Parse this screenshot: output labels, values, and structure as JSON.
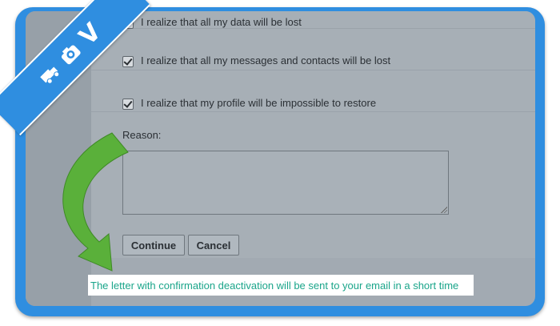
{
  "checkboxes": [
    {
      "label": "I realize that all my data will be lost",
      "checked": true
    },
    {
      "label": "I realize that all my messages and contacts will be lost",
      "checked": true
    },
    {
      "label": "I realize that my profile will be impossible to restore",
      "checked": true
    }
  ],
  "reason": {
    "label": "Reason:",
    "value": ""
  },
  "buttons": {
    "continue": "Continue",
    "cancel": "Cancel"
  },
  "notice": "The letter with confirmation deactivation will be sent to your email in a short time",
  "ribbon": {
    "letter": "V",
    "icons": [
      "camera-icon",
      "truck-icon"
    ]
  },
  "colors": {
    "frame": "#2f8ee0",
    "arrow": "#5ab03a",
    "notice_text": "#1aa58a"
  }
}
